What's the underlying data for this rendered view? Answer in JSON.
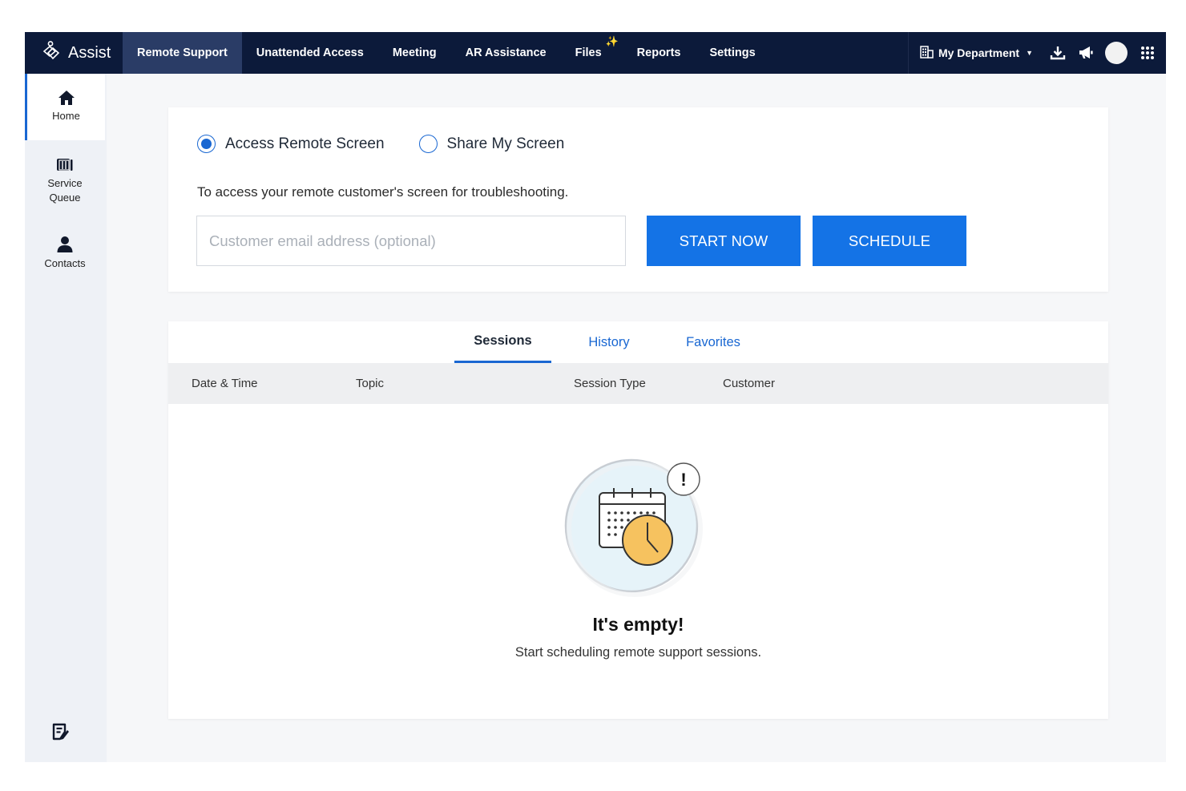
{
  "app": {
    "brand": "Assist"
  },
  "nav": {
    "items": [
      "Remote Support",
      "Unattended Access",
      "Meeting",
      "AR Assistance",
      "Files",
      "Reports",
      "Settings"
    ],
    "department": "My Department"
  },
  "sidebar": {
    "items": [
      {
        "label": "Home"
      },
      {
        "label_line1": "Service",
        "label_line2": "Queue"
      },
      {
        "label": "Contacts"
      }
    ]
  },
  "start_card": {
    "radio_access": "Access Remote Screen",
    "radio_share": "Share My Screen",
    "description": "To access your remote customer's screen for troubleshooting.",
    "email_placeholder": "Customer email address (optional)",
    "start_button": "START NOW",
    "schedule_button": "SCHEDULE"
  },
  "sessions": {
    "tabs": [
      "Sessions",
      "History",
      "Favorites"
    ],
    "columns": [
      "Date & Time",
      "Topic",
      "Session Type",
      "Customer"
    ],
    "empty_title": "It's empty!",
    "empty_subtitle": "Start scheduling remote support sessions."
  },
  "colors": {
    "topbar": "#0c1a3a",
    "accent": "#1473e6",
    "active_nav": "#2a3c66"
  }
}
